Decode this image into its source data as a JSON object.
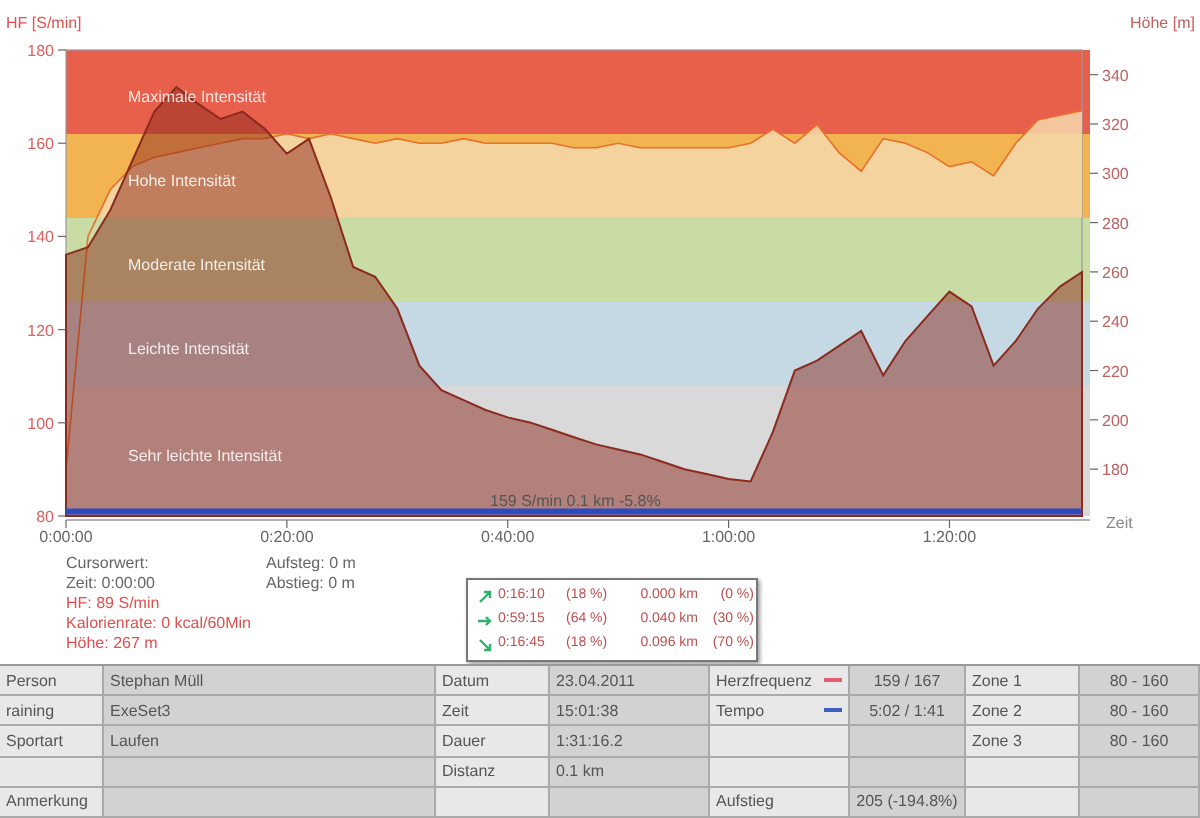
{
  "chart": {
    "annotation": "159 S/min 0.1 km -5.8%",
    "zones": [
      {
        "label": "Maximale Intensität",
        "color": "#e8604c"
      },
      {
        "label": "Hohe Intensität",
        "color": "#f2b450"
      },
      {
        "label": "Moderate Intensität",
        "color": "#c9dca4"
      },
      {
        "label": "Leichte Intensität",
        "color": "#c5d9e5"
      },
      {
        "label": "Sehr leichte Intensität",
        "color": "#d9d9d9"
      }
    ],
    "chart_data": {
      "type": "area",
      "xlabel": "Zeit",
      "ylabel": "HF [S/min]",
      "y2label": "Höhe [m]",
      "xlim": [
        0,
        92
      ],
      "ylim": [
        80,
        180
      ],
      "y2lim": [
        161,
        350
      ],
      "xticks": [
        {
          "value": 0,
          "label": "0:00:00"
        },
        {
          "value": 20,
          "label": "0:20:00"
        },
        {
          "value": 40,
          "label": "0:40:00"
        },
        {
          "value": 60,
          "label": "1:00:00"
        },
        {
          "value": 80,
          "label": "1:20:00"
        }
      ],
      "yticks": [
        80,
        100,
        120,
        140,
        160,
        180
      ],
      "y2ticks": [
        180,
        200,
        220,
        240,
        260,
        280,
        300,
        320,
        340
      ],
      "x": [
        0,
        2,
        4,
        6,
        8,
        10,
        12,
        14,
        16,
        18,
        20,
        22,
        24,
        26,
        28,
        30,
        32,
        34,
        36,
        38,
        40,
        42,
        44,
        46,
        48,
        50,
        52,
        54,
        56,
        58,
        60,
        62,
        64,
        66,
        68,
        70,
        72,
        74,
        76,
        78,
        80,
        82,
        84,
        86,
        88,
        90,
        92
      ],
      "series": [
        {
          "type": "area",
          "color": "#e8702a",
          "values": [
            90,
            140,
            150,
            155,
            157,
            158,
            159,
            160,
            161,
            161,
            162,
            161,
            162,
            161,
            160,
            161,
            160,
            160,
            161,
            160,
            160,
            160,
            160,
            159,
            159,
            160,
            159,
            159,
            159,
            159,
            159,
            160,
            163,
            160,
            164,
            158,
            154,
            161,
            160,
            158,
            155,
            156,
            153,
            160,
            165,
            166,
            167
          ]
        },
        {
          "type": "area",
          "color": "#8b2a1e",
          "axis": "y2",
          "values": [
            267,
            270,
            285,
            305,
            325,
            335,
            328,
            322,
            325,
            318,
            308,
            314,
            290,
            262,
            258,
            245,
            222,
            212,
            208,
            204,
            201,
            199,
            196,
            193,
            190,
            188,
            186,
            183,
            180,
            178,
            176,
            175,
            195,
            220,
            224,
            230,
            236,
            218,
            232,
            242,
            252,
            246,
            222,
            232,
            245,
            254,
            260
          ]
        },
        {
          "type": "line",
          "color": "#2a4cc0",
          "values": [
            81,
            81,
            81,
            81,
            81,
            81,
            81,
            81,
            81,
            81,
            81,
            81,
            81,
            81,
            81,
            81,
            81,
            81,
            81,
            81,
            81,
            81,
            81,
            81,
            81,
            81,
            81,
            81,
            81,
            81,
            81,
            81,
            81,
            81,
            81,
            81,
            81,
            81,
            81,
            81,
            81,
            81,
            81,
            81,
            81,
            81,
            81
          ]
        }
      ]
    }
  },
  "cursor": {
    "left": [
      {
        "text": "Cursorwert:",
        "kind": "plain"
      },
      {
        "text": "Zeit: 0:00:00",
        "kind": "plain"
      },
      {
        "text": "HF: 89 S/min",
        "kind": "hf"
      },
      {
        "text": "Kalorienrate: 0 kcal/60Min",
        "kind": "hf"
      },
      {
        "text": "Höhe: 267 m",
        "kind": "hf"
      }
    ],
    "right": [
      {
        "text": "Aufsteg: 0 m",
        "kind": "plain"
      },
      {
        "text": "Abstieg: 0 m",
        "kind": "plain"
      }
    ]
  },
  "segments": [
    {
      "kind": "up",
      "time": "0:16:10",
      "time_pct": "(18 %)",
      "distance": "0.000 km",
      "distance_pct": "(0 %)"
    },
    {
      "kind": "flat",
      "time": "0:59:15",
      "time_pct": "(64 %)",
      "distance": "0.040 km",
      "distance_pct": "(30 %)"
    },
    {
      "kind": "down",
      "time": "0:16:45",
      "time_pct": "(18 %)",
      "distance": "0.096 km",
      "distance_pct": "(70 %)"
    }
  ],
  "table": {
    "rows": [
      [
        {
          "text": "Person"
        },
        {
          "text": "Stephan Müll"
        },
        {
          "text": "Datum"
        },
        {
          "text": "23.04.2011"
        },
        {
          "text": "Herzfrequenz",
          "color": "#e06070"
        },
        {
          "text": "159 / 167"
        },
        {
          "text": "Zone 1"
        },
        {
          "text": "80 - 160"
        }
      ],
      [
        {
          "text": "raining"
        },
        {
          "text": "ExeSet3"
        },
        {
          "text": "Zeit"
        },
        {
          "text": "15:01:38"
        },
        {
          "text": "Tempo",
          "color": "#4060c0"
        },
        {
          "text": "5:02 / 1:41"
        },
        {
          "text": "Zone 2"
        },
        {
          "text": "80 - 160"
        }
      ],
      [
        {
          "text": "Sportart"
        },
        {
          "text": "Laufen"
        },
        {
          "text": "Dauer"
        },
        {
          "text": "1:31:16.2"
        },
        {},
        {},
        {
          "text": "Zone 3"
        },
        {
          "text": "80 - 160"
        }
      ],
      [
        {},
        {},
        {
          "text": "Distanz"
        },
        {
          "text": "0.1 km"
        },
        {},
        {},
        {},
        {}
      ],
      [
        {
          "text": "Anmerkung"
        },
        {},
        {},
        {},
        {
          "text": "Aufstieg"
        },
        {
          "text": "205 (-194.8%)"
        },
        {},
        {}
      ]
    ]
  }
}
